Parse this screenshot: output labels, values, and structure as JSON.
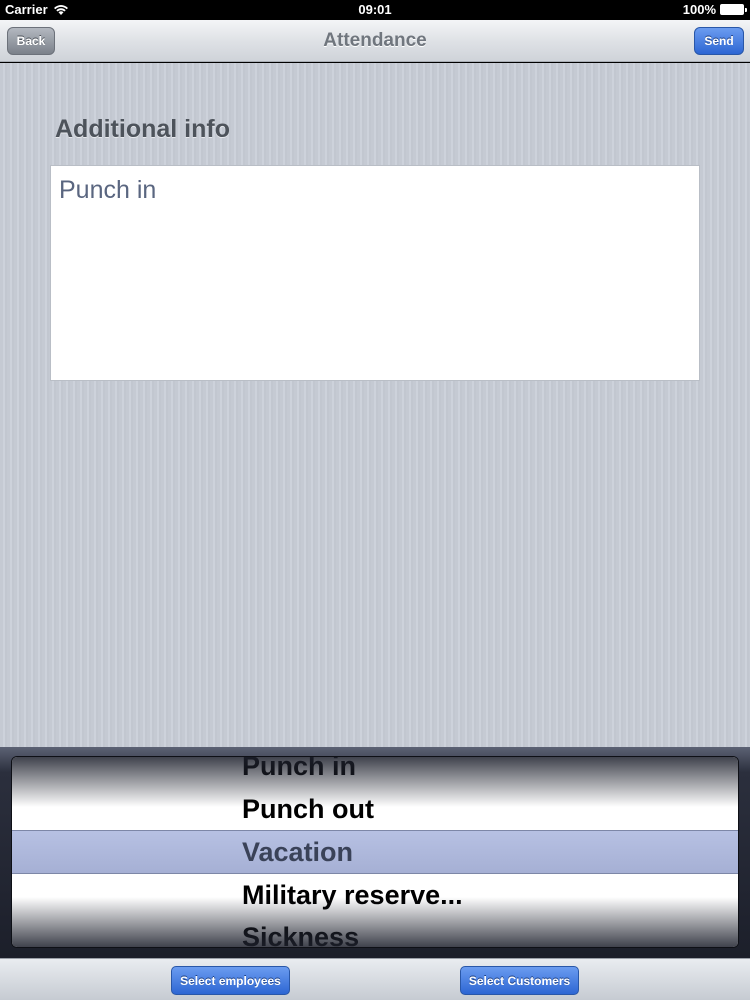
{
  "status_bar": {
    "carrier": "Carrier",
    "time": "09:01",
    "battery": "100%"
  },
  "nav": {
    "title": "Attendance",
    "back_label": "Back",
    "send_label": "Send"
  },
  "content": {
    "section_title": "Additional info",
    "info_text": "Punch in"
  },
  "picker": {
    "items": [
      "Punch in",
      "Punch out",
      "Vacation",
      "Military reserve...",
      "Sickness"
    ],
    "selected": "Vacation"
  },
  "toolbar": {
    "select_employees_label": "Select employees",
    "select_customers_label": "Select Customers"
  },
  "colors": {
    "accent_blue": "#2d66d3",
    "background": "#c7ccd5"
  }
}
